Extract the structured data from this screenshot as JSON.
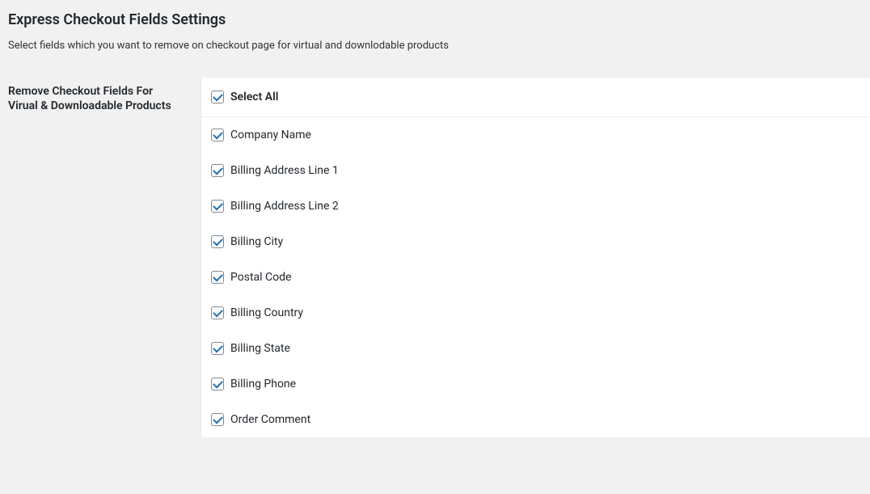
{
  "page": {
    "title": "Express Checkout Fields Settings",
    "description": "Select fields which you want to remove on checkout page for virtual and downlodable products"
  },
  "section": {
    "label": "Remove Checkout Fields For Virual & Downloadable Products"
  },
  "selectAll": {
    "label": "Select All",
    "checked": true
  },
  "fields": [
    {
      "label": "Company Name",
      "checked": true
    },
    {
      "label": "Billing Address Line 1",
      "checked": true
    },
    {
      "label": "Billing Address Line 2",
      "checked": true
    },
    {
      "label": "Billing City",
      "checked": true
    },
    {
      "label": "Postal Code",
      "checked": true
    },
    {
      "label": "Billing Country",
      "checked": true
    },
    {
      "label": "Billing State",
      "checked": true
    },
    {
      "label": "Billing Phone",
      "checked": true
    },
    {
      "label": "Order Comment",
      "checked": true
    }
  ]
}
